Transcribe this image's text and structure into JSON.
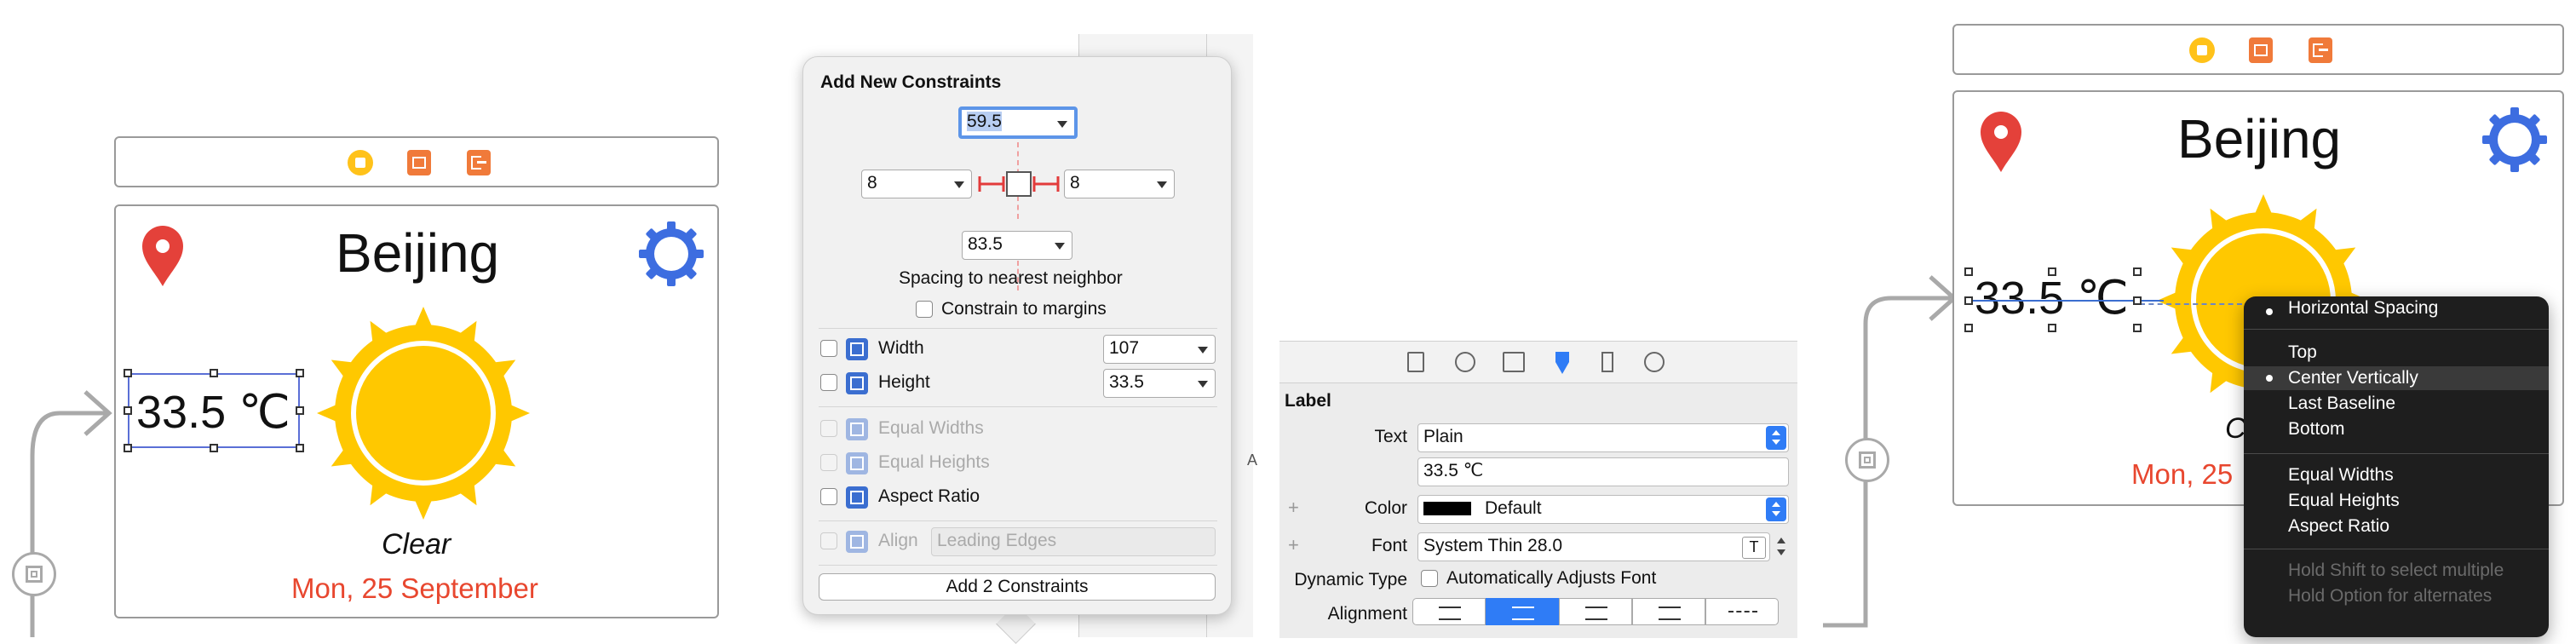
{
  "left_scene": {
    "city": "Beijing",
    "temperature": "33.5 ℃",
    "condition": "Clear",
    "date": "Mon, 25 September"
  },
  "constraints_popover": {
    "title": "Add New Constraints",
    "top_value": "59.5",
    "left_value": "8",
    "right_value": "8",
    "bottom_value": "83.5",
    "spacing_caption": "Spacing to nearest neighbor",
    "constrain_margins_label": "Constrain to margins",
    "width_label": "Width",
    "width_value": "107",
    "height_label": "Height",
    "height_value": "33.5",
    "equal_widths_label": "Equal Widths",
    "equal_heights_label": "Equal Heights",
    "aspect_ratio_label": "Aspect Ratio",
    "align_label": "Align",
    "align_value": "Leading Edges",
    "add_button_label": "Add 2 Constraints"
  },
  "attributes_inspector": {
    "section_title": "Label",
    "text_label": "Text",
    "text_type": "Plain",
    "text_value": "33.5 ℃",
    "color_label": "Color",
    "color_value": "Default",
    "font_label": "Font",
    "font_value": "System Thin 28.0",
    "dynamic_type_label": "Dynamic Type",
    "auto_adjust_label": "Automatically Adjusts Font",
    "alignment_label": "Alignment",
    "plus_glyph": "+",
    "partial_letter": "A"
  },
  "right_scene": {
    "city": "Beijing",
    "temperature": "33.5 ℃",
    "condition_partial": "C",
    "date_partial": "Mon, 25"
  },
  "context_menu": {
    "items": [
      {
        "label": "Horizontal Spacing",
        "bullet": true,
        "highlighted": false,
        "disabled": false
      },
      {
        "label": "Top",
        "bullet": false,
        "highlighted": false,
        "disabled": false
      },
      {
        "label": "Center Vertically",
        "bullet": true,
        "highlighted": true,
        "disabled": false
      },
      {
        "label": "Last Baseline",
        "bullet": false,
        "highlighted": false,
        "disabled": false
      },
      {
        "label": "Bottom",
        "bullet": false,
        "highlighted": false,
        "disabled": false
      },
      {
        "label": "Equal Widths",
        "bullet": false,
        "highlighted": false,
        "disabled": false
      },
      {
        "label": "Equal Heights",
        "bullet": false,
        "highlighted": false,
        "disabled": false
      },
      {
        "label": "Aspect Ratio",
        "bullet": false,
        "highlighted": false,
        "disabled": false
      },
      {
        "label": "Hold Shift to select multiple",
        "bullet": false,
        "highlighted": false,
        "disabled": true
      },
      {
        "label": "Hold Option for alternates",
        "bullet": false,
        "highlighted": false,
        "disabled": true
      }
    ]
  },
  "colors": {
    "accent_red": "#e8472f",
    "selection_blue": "#2f7cf6",
    "sun_yellow": "#ffc800",
    "gear_blue": "#3d6de0"
  }
}
